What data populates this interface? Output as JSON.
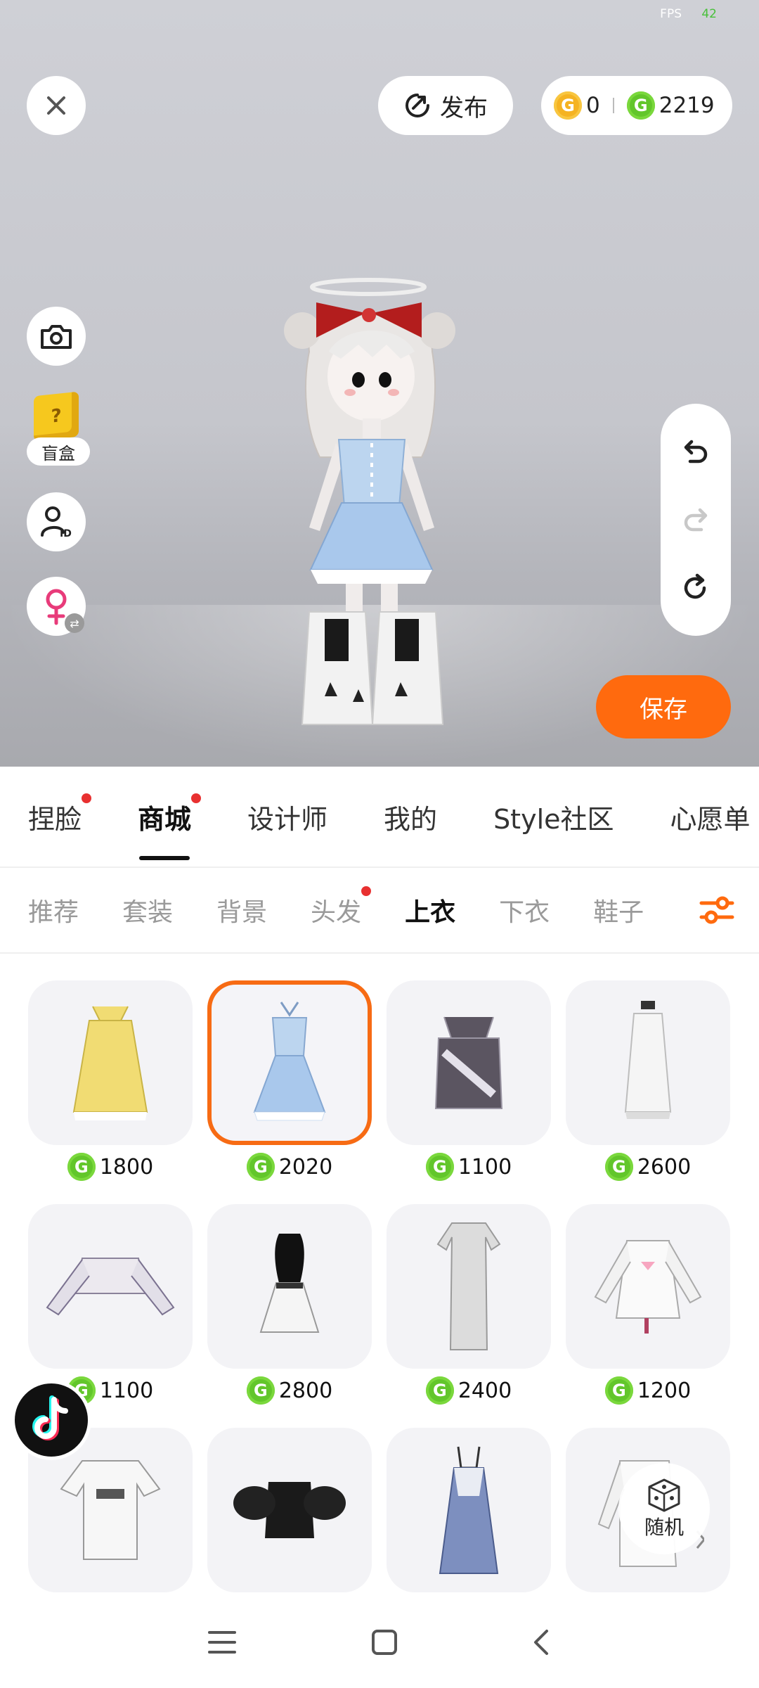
{
  "status": {
    "fps_label": "FPS",
    "fps_value": "42"
  },
  "header": {
    "publish_label": "发布",
    "currency_gold": "0",
    "currency_green": "2219"
  },
  "left_tools": {
    "blindbox_label": "盲盒",
    "blindbox_glyph": "?"
  },
  "actions": {
    "save_label": "保存",
    "random_label": "随机"
  },
  "main_tabs": [
    {
      "label": "捏脸",
      "dot": true
    },
    {
      "label": "商城",
      "dot": true,
      "active": true
    },
    {
      "label": "设计师"
    },
    {
      "label": "我的"
    },
    {
      "label": "Style社区"
    },
    {
      "label": "心愿单"
    }
  ],
  "sub_tabs": [
    {
      "label": "推荐"
    },
    {
      "label": "套装"
    },
    {
      "label": "背景"
    },
    {
      "label": "头发",
      "dot": true
    },
    {
      "label": "上衣",
      "active": true
    },
    {
      "label": "下衣"
    },
    {
      "label": "鞋子"
    }
  ],
  "items": [
    {
      "name": "yellow-slip-dress",
      "price": "1800"
    },
    {
      "name": "blue-lace-dress",
      "price": "2020",
      "selected": true
    },
    {
      "name": "gray-camisole",
      "price": "1100"
    },
    {
      "name": "white-slip-dress",
      "price": "2600"
    },
    {
      "name": "lace-crop-cardigan",
      "price": "1100"
    },
    {
      "name": "black-bustier-dress",
      "price": "2800"
    },
    {
      "name": "lace-long-dress",
      "price": "2400"
    },
    {
      "name": "white-hoodie",
      "price": "1200"
    },
    {
      "name": "white-graphic-tee",
      "price": ""
    },
    {
      "name": "black-puff-top",
      "price": ""
    },
    {
      "name": "blue-gingham-dress",
      "price": ""
    },
    {
      "name": "white-coat",
      "price": ""
    }
  ],
  "colors": {
    "accent": "#ff6a0e",
    "coin_green": "#62c62b",
    "coin_gold": "#f5b322",
    "dot": "#e83030"
  },
  "icons": [
    "close-icon",
    "publish-icon",
    "camera-icon",
    "user-id-icon",
    "female-icon",
    "undo-icon",
    "redo-icon",
    "reset-icon",
    "filter-icon",
    "dice-icon",
    "tiktok-icon",
    "menu-icon",
    "home-icon",
    "back-icon"
  ]
}
